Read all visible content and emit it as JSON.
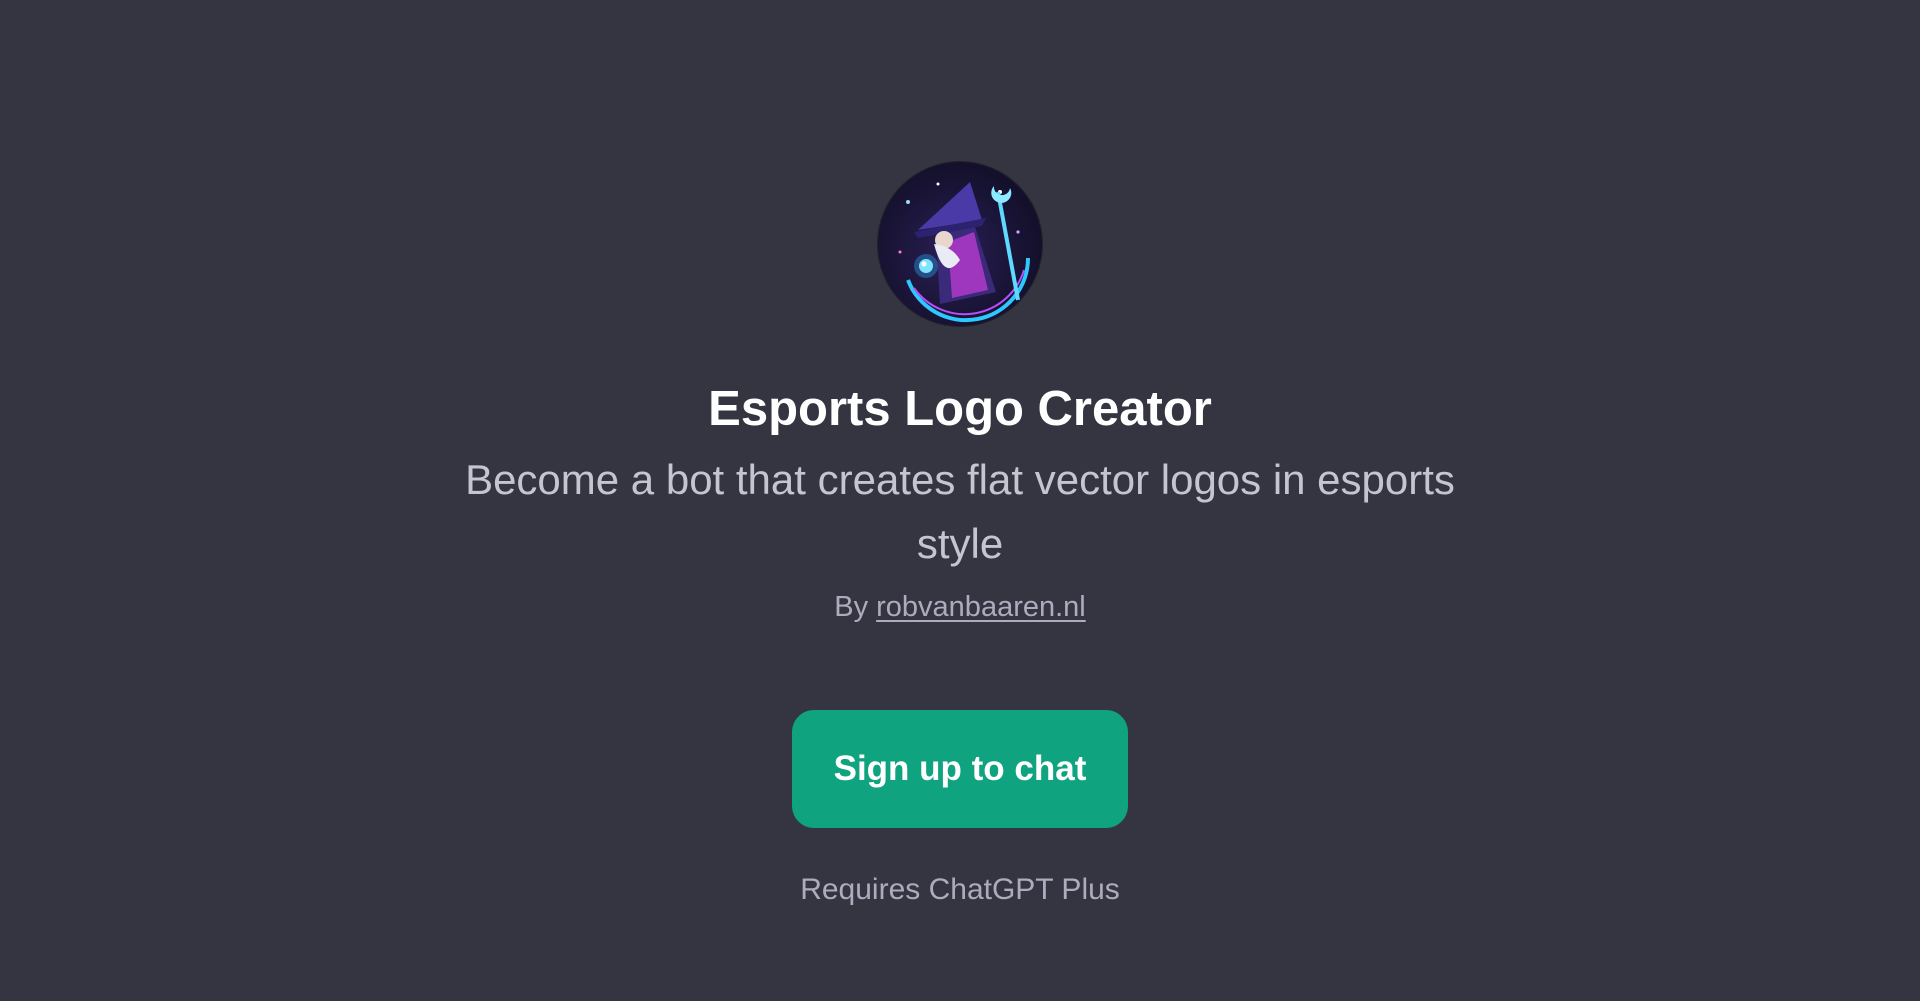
{
  "gpt": {
    "avatar_icon": "wizard-logo-icon",
    "title": "Esports Logo Creator",
    "description": "Become a bot that creates flat vector logos in esports style",
    "by_prefix": "By",
    "author": "robvanbaaren.nl"
  },
  "cta": {
    "signup_label": "Sign up to chat",
    "requires_text": "Requires ChatGPT Plus"
  },
  "colors": {
    "background": "#343541",
    "button": "#10a37f",
    "title": "#ffffff",
    "muted": "#acacbe"
  }
}
